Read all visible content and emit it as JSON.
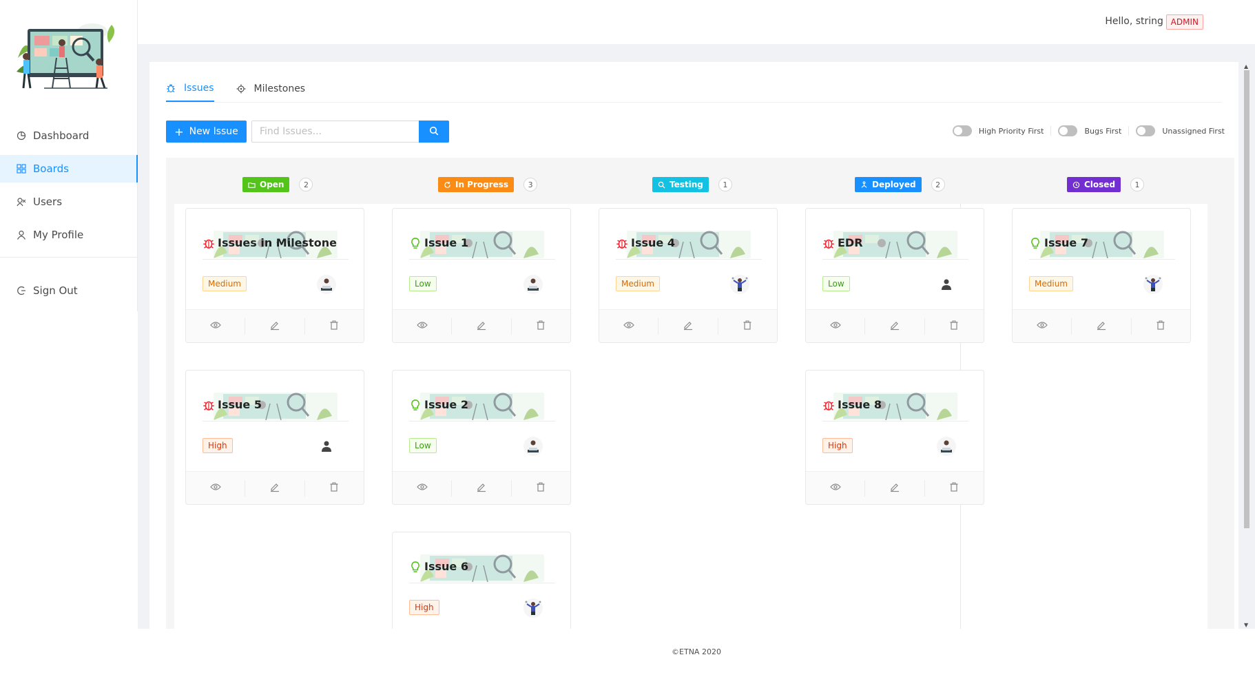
{
  "header": {
    "hello": "Hello,  string  !",
    "role": "ADMIN"
  },
  "sidebar": {
    "items": [
      {
        "label": "Dashboard",
        "icon": "pie-chart-icon"
      },
      {
        "label": "Boards",
        "icon": "grid-icon",
        "active": true
      },
      {
        "label": "Users",
        "icon": "users-icon"
      },
      {
        "label": "My Profile",
        "icon": "user-icon"
      }
    ],
    "signout": "Sign Out"
  },
  "tabs": [
    {
      "label": "Issues",
      "icon": "bug-icon",
      "active": true
    },
    {
      "label": "Milestones",
      "icon": "target-icon"
    }
  ],
  "toolbar": {
    "new_issue": "New Issue",
    "search_placeholder": "Find Issues...",
    "toggles": [
      "High Priority First",
      "Bugs First",
      "Unassigned First"
    ]
  },
  "columns": [
    {
      "label": "Open",
      "count": "2",
      "color": "#52c41a"
    },
    {
      "label": "In Progress",
      "count": "3",
      "color": "#fa8c16"
    },
    {
      "label": "Testing",
      "count": "1",
      "color": "#13c2e2"
    },
    {
      "label": "Deployed",
      "count": "2",
      "color": "#1890ff"
    },
    {
      "label": "Closed",
      "count": "1",
      "color": "#722ed1"
    }
  ],
  "cards": [
    {
      "title": "Issues in Milestone",
      "type": "bug",
      "priority": "Medium",
      "avatar": "person-laptop"
    },
    {
      "title": "Issue 1",
      "type": "idea",
      "priority": "Low",
      "avatar": "person-laptop"
    },
    {
      "title": "Issue 4",
      "type": "bug",
      "priority": "Medium",
      "avatar": "person-juggling"
    },
    {
      "title": "EDR",
      "type": "bug",
      "priority": "Low",
      "avatar": "user-silhouette"
    },
    {
      "title": "Issue 7",
      "type": "idea",
      "priority": "Medium",
      "avatar": "person-juggling"
    },
    {
      "title": "Issue 5",
      "type": "bug",
      "priority": "High",
      "avatar": "user-silhouette"
    },
    {
      "title": "Issue 2",
      "type": "idea",
      "priority": "Low",
      "avatar": "person-laptop"
    },
    {
      "title": "Issue 8",
      "type": "bug",
      "priority": "High",
      "avatar": "person-laptop"
    },
    {
      "title": "Issue 6",
      "type": "idea",
      "priority": "High",
      "avatar": "person-juggling"
    }
  ],
  "footer": "©ETNA 2020"
}
